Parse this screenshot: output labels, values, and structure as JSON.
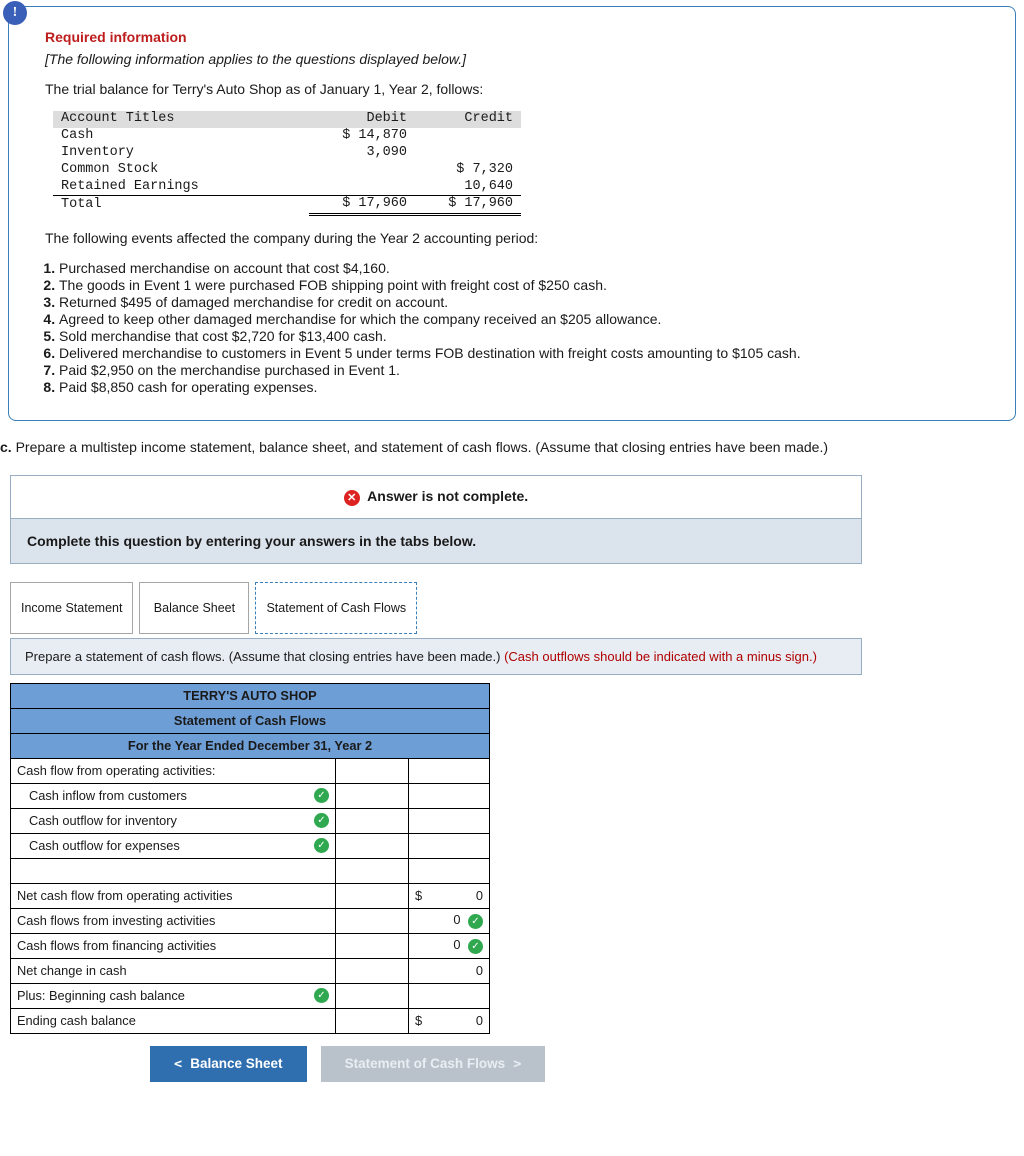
{
  "card": {
    "heading": "Required information",
    "note": "[The following information applies to the questions displayed below.]",
    "intro": "The trial balance for Terry's Auto Shop as of January 1, Year 2, follows:",
    "tb_head": {
      "acct": "Account Titles",
      "debit": "Debit",
      "credit": "Credit"
    },
    "tb": [
      {
        "acct": "Cash",
        "debit": "$ 14,870",
        "credit": ""
      },
      {
        "acct": "Inventory",
        "debit": "3,090",
        "credit": ""
      },
      {
        "acct": "Common Stock",
        "debit": "",
        "credit": "$ 7,320"
      },
      {
        "acct": "Retained Earnings",
        "debit": "",
        "credit": "10,640"
      }
    ],
    "tb_total": {
      "acct": "Total",
      "debit": "$ 17,960",
      "credit": "$ 17,960"
    },
    "events_intro": "The following events affected the company during the Year 2 accounting period:",
    "events": [
      "Purchased merchandise on account that cost $4,160.",
      "The goods in Event 1 were purchased FOB shipping point with freight cost of $250 cash.",
      "Returned $495 of damaged merchandise for credit on account.",
      "Agreed to keep other damaged merchandise for which the company received an $205 allowance.",
      "Sold merchandise that cost $2,720 for $13,400 cash.",
      "Delivered merchandise to customers in Event 5 under terms FOB destination with freight costs amounting to $105 cash.",
      "Paid $2,950 on the merchandise purchased in Event 1.",
      "Paid $8,850 cash for operating expenses."
    ]
  },
  "partc_label": "c.",
  "partc_text": "Prepare a multistep income statement, balance sheet, and statement of cash flows. (Assume that closing entries have been made.)",
  "panel": {
    "banner": "Answer is not complete.",
    "sub": "Complete this question by entering your answers in the tabs below."
  },
  "tabs": {
    "t1": "Income Statement",
    "t2": "Balance Sheet",
    "t3": "Statement of Cash Flows"
  },
  "instr": {
    "black": "Prepare a statement of cash flows. (Assume that closing entries have been made.) ",
    "red": "(Cash outflows should be indicated with a minus sign.)"
  },
  "stmt": {
    "h1": "TERRY'S AUTO SHOP",
    "h2": "Statement of Cash Flows",
    "h3": "For the Year Ended December 31, Year 2",
    "r_op_head": "Cash flow from operating activities:",
    "r_inflow": "Cash inflow from customers",
    "r_out_inv": "Cash outflow for inventory",
    "r_out_exp": "Cash outflow for expenses",
    "r_net_op": "Net cash flow from operating activities",
    "r_inv": "Cash flows from investing activities",
    "r_fin": "Cash flows from financing activities",
    "r_netchg": "Net change in cash",
    "r_beg": "Plus: Beginning cash balance",
    "r_end": "Ending cash balance",
    "dollar": "$",
    "zero": "0"
  },
  "nav": {
    "prev": "Balance Sheet",
    "next": "Statement of Cash Flows"
  }
}
